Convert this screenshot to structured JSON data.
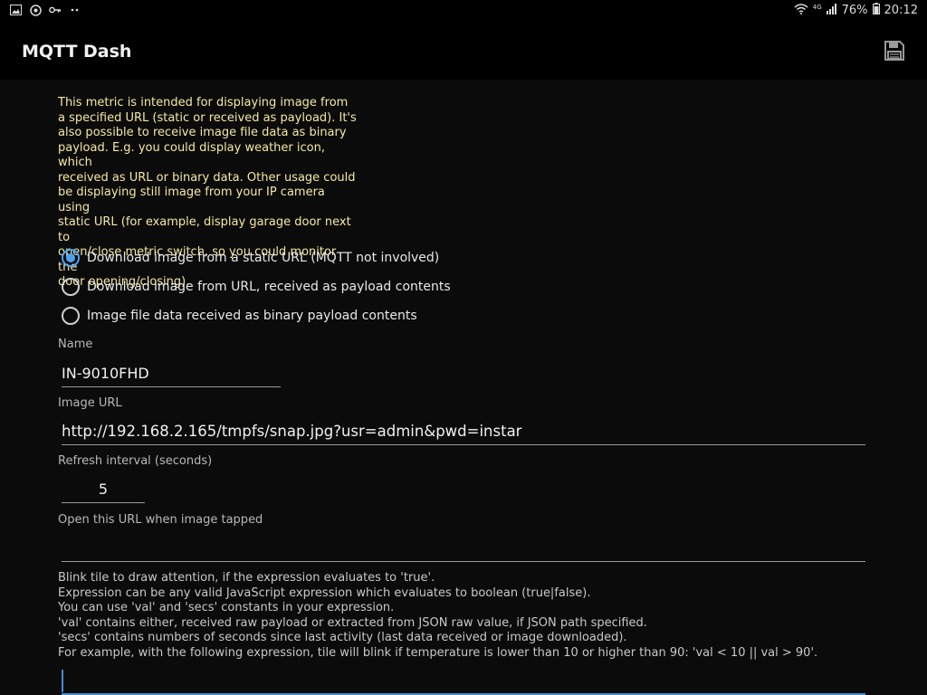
{
  "status_bar": {
    "left_icons": [
      "gallery-icon",
      "settings-icon",
      "key-icon",
      "more-dots-icon"
    ],
    "network": "4G",
    "battery": "76%",
    "time": "20:12"
  },
  "app_bar": {
    "title": "MQTT Dash",
    "save_icon": "save-icon"
  },
  "intro": {
    "lines": [
      "This metric is intended for displaying image from",
      "a specified URL (static or received as payload). It's",
      "also possible to receive image file data as binary",
      "payload. E.g. you could display weather icon, which",
      "received as URL or binary data. Other usage could",
      "be displaying still image from your IP camera using",
      "static URL (for example, display garage door next to",
      "open/close metric switch, so you could monitor the",
      "door opening/closing)."
    ]
  },
  "source_options": {
    "selected": 0,
    "items": [
      "Download image from a static URL (MQTT not involved)",
      "Download image from URL, received as payload contents",
      "Image file data received as binary payload contents"
    ]
  },
  "fields": {
    "name": {
      "label": "Name",
      "value": "IN-9010FHD"
    },
    "image_url": {
      "label": "Image URL",
      "value": "http://192.168.2.165/tmpfs/snap.jpg?usr=admin&pwd=instar"
    },
    "refresh": {
      "label": "Refresh interval (seconds)",
      "value": "5"
    },
    "open_url": {
      "label": "Open this URL when image tapped",
      "value": ""
    }
  },
  "blink": {
    "help_lines": [
      "Blink tile to draw attention, if the expression evaluates to 'true'.",
      "Expression can be any valid JavaScript expression which evaluates to boolean (true|false).",
      "You can use 'val' and 'secs' constants in your expression.",
      "'val' contains either, received raw payload or extracted from JSON raw value, if JSON path specified.",
      "'secs' contains numbers of seconds since last activity (last data received or image downloaded).",
      "For example, with the following expression, tile will blink if temperature is lower than 10 or higher than 90: 'val < 10 || val > 90'."
    ],
    "expression_value": ""
  },
  "colors": {
    "accent": "#4aa3f0",
    "intro_text": "#f4e8a2",
    "background": "#0b0b0b"
  }
}
